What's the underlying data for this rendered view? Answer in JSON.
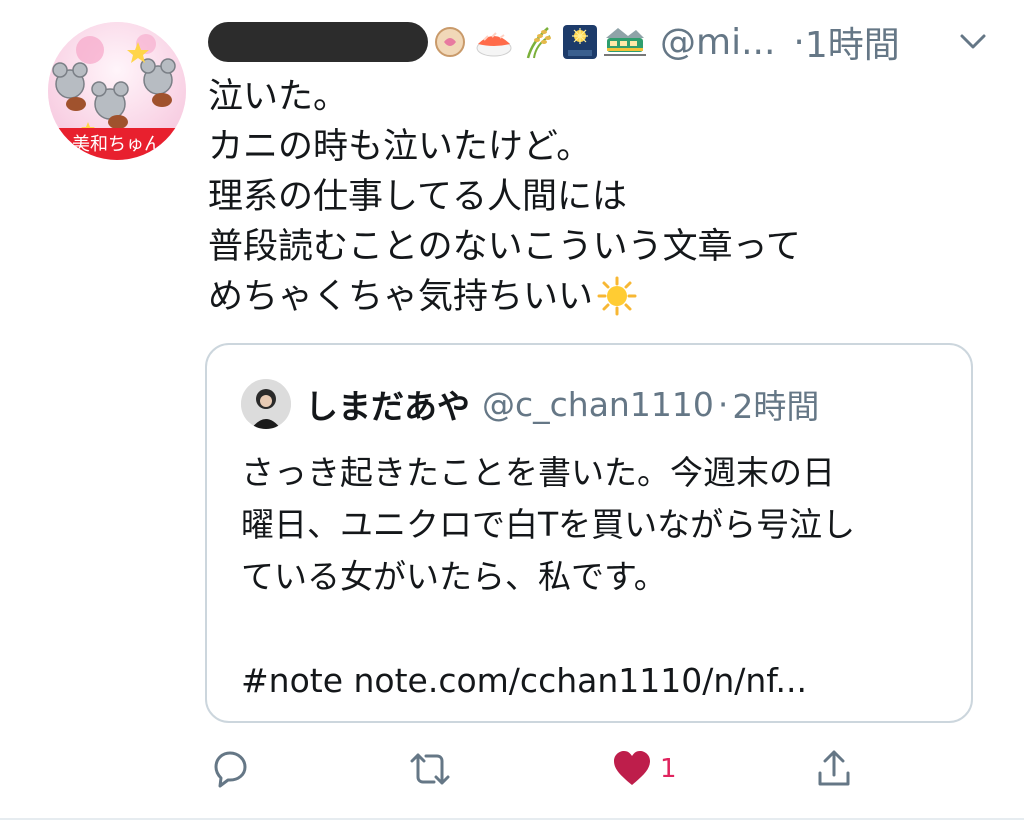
{
  "tweet": {
    "handle": "@mi...",
    "time_separator": "·",
    "time": "1時間",
    "body_lines": [
      "泣いた。",
      "カニの時も泣いたけど。",
      "理系の仕事してる人間には",
      "普段読むことのないこういう文章って",
      "めちゃくちゃ気持ちいい"
    ],
    "name_emojis": [
      "fish-cake-emoji",
      "sushi-emoji",
      "rice-plant-emoji",
      "fireworks-emoji",
      "train-emoji"
    ],
    "trailing_emoji": "sun-emoji",
    "avatar_banner_text": "美和ちゅん"
  },
  "quoted": {
    "name": "しまだあや",
    "handle": "@c_chan1110",
    "separator": "·",
    "time": "2時間",
    "text_lines": [
      "さっき起きたことを書いた。今週末の日",
      "曜日、ユニクロで白Tを買いながら号泣し",
      "ている女がいたら、私です。",
      "",
      "#note note.com/cchan1110/n/nf..."
    ]
  },
  "actions": {
    "like_count": "1",
    "like_color": "#be1e4b",
    "muted_color": "#657786"
  }
}
